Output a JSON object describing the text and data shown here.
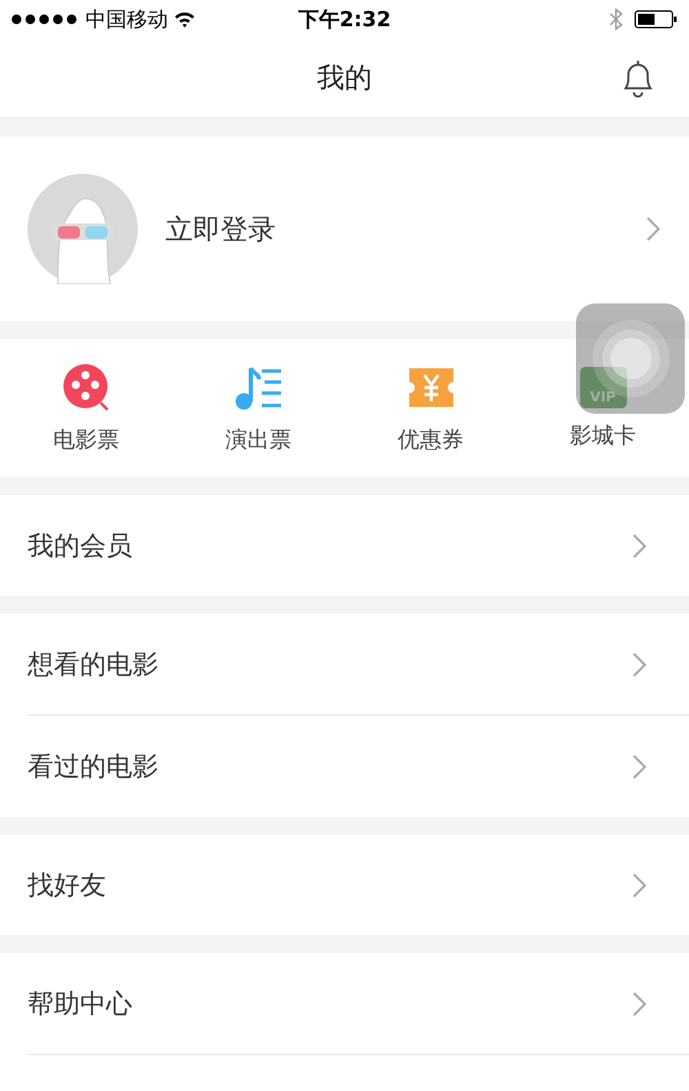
{
  "status_bar": {
    "carrier": "中国移动",
    "time": "下午2:32"
  },
  "nav": {
    "title": "我的"
  },
  "profile": {
    "label": "立即登录"
  },
  "shortcuts": [
    {
      "kind": "film",
      "label": "电影票"
    },
    {
      "kind": "music",
      "label": "演出票"
    },
    {
      "kind": "coupon",
      "label": "优惠券"
    },
    {
      "kind": "card",
      "label": "影城卡",
      "icon_text": "VIP"
    }
  ],
  "menu_groups": [
    {
      "items": [
        {
          "label": "我的会员"
        }
      ]
    },
    {
      "items": [
        {
          "label": "想看的电影"
        },
        {
          "label": "看过的电影"
        }
      ]
    },
    {
      "items": [
        {
          "label": "找好友"
        }
      ]
    },
    {
      "items": [
        {
          "label": "帮助中心"
        }
      ]
    }
  ]
}
